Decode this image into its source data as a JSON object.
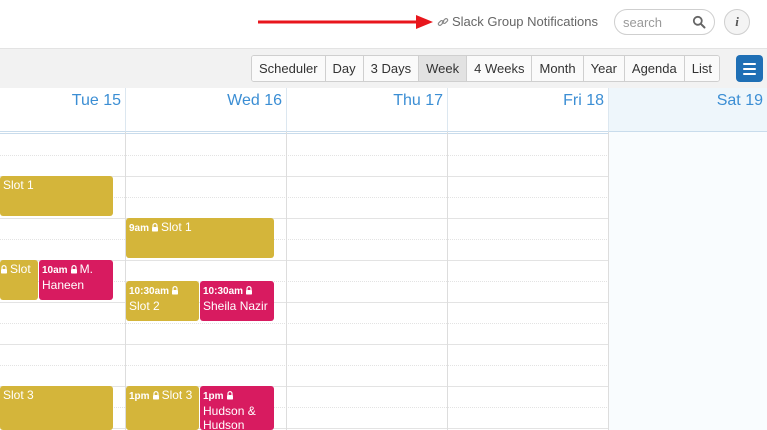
{
  "topbar": {
    "slack_link_label": "Slack Group Notifications",
    "search_placeholder": "search",
    "info_label": "i"
  },
  "views": [
    {
      "label": "Scheduler",
      "active": false
    },
    {
      "label": "Day",
      "active": false
    },
    {
      "label": "3 Days",
      "active": false
    },
    {
      "label": "Week",
      "active": true
    },
    {
      "label": "4 Weeks",
      "active": false
    },
    {
      "label": "Month",
      "active": false
    },
    {
      "label": "Year",
      "active": false
    },
    {
      "label": "Agenda",
      "active": false
    },
    {
      "label": "List",
      "active": false
    }
  ],
  "days": [
    {
      "label": "Tue 15"
    },
    {
      "label": "Wed 16"
    },
    {
      "label": "Thu 17"
    },
    {
      "label": "Fri 18"
    },
    {
      "label": "Sat 19"
    }
  ],
  "events": {
    "tue_slot1": {
      "title": "Slot 1"
    },
    "tue_slot_mid": {
      "title": "Slot"
    },
    "tue_haneen": {
      "time": "10am",
      "title": "M. Haneen"
    },
    "tue_slot3": {
      "title": "Slot 3"
    },
    "wed_slot1": {
      "time": "9am",
      "title": "Slot 1"
    },
    "wed_slot2": {
      "time": "10:30am",
      "title": "Slot 2"
    },
    "wed_sheila": {
      "time": "10:30am",
      "title": "Sheila Nazir"
    },
    "wed_slot3": {
      "time": "1pm",
      "title": "Slot 3"
    },
    "wed_hudson": {
      "time": "1pm",
      "title": "Hudson & Hudson"
    }
  },
  "colors": {
    "slot": "#d4b53a",
    "booked": "#d81b60",
    "accent": "#3b8ed4",
    "menu_button": "#1f6fb5",
    "arrow": "#e8161c"
  }
}
